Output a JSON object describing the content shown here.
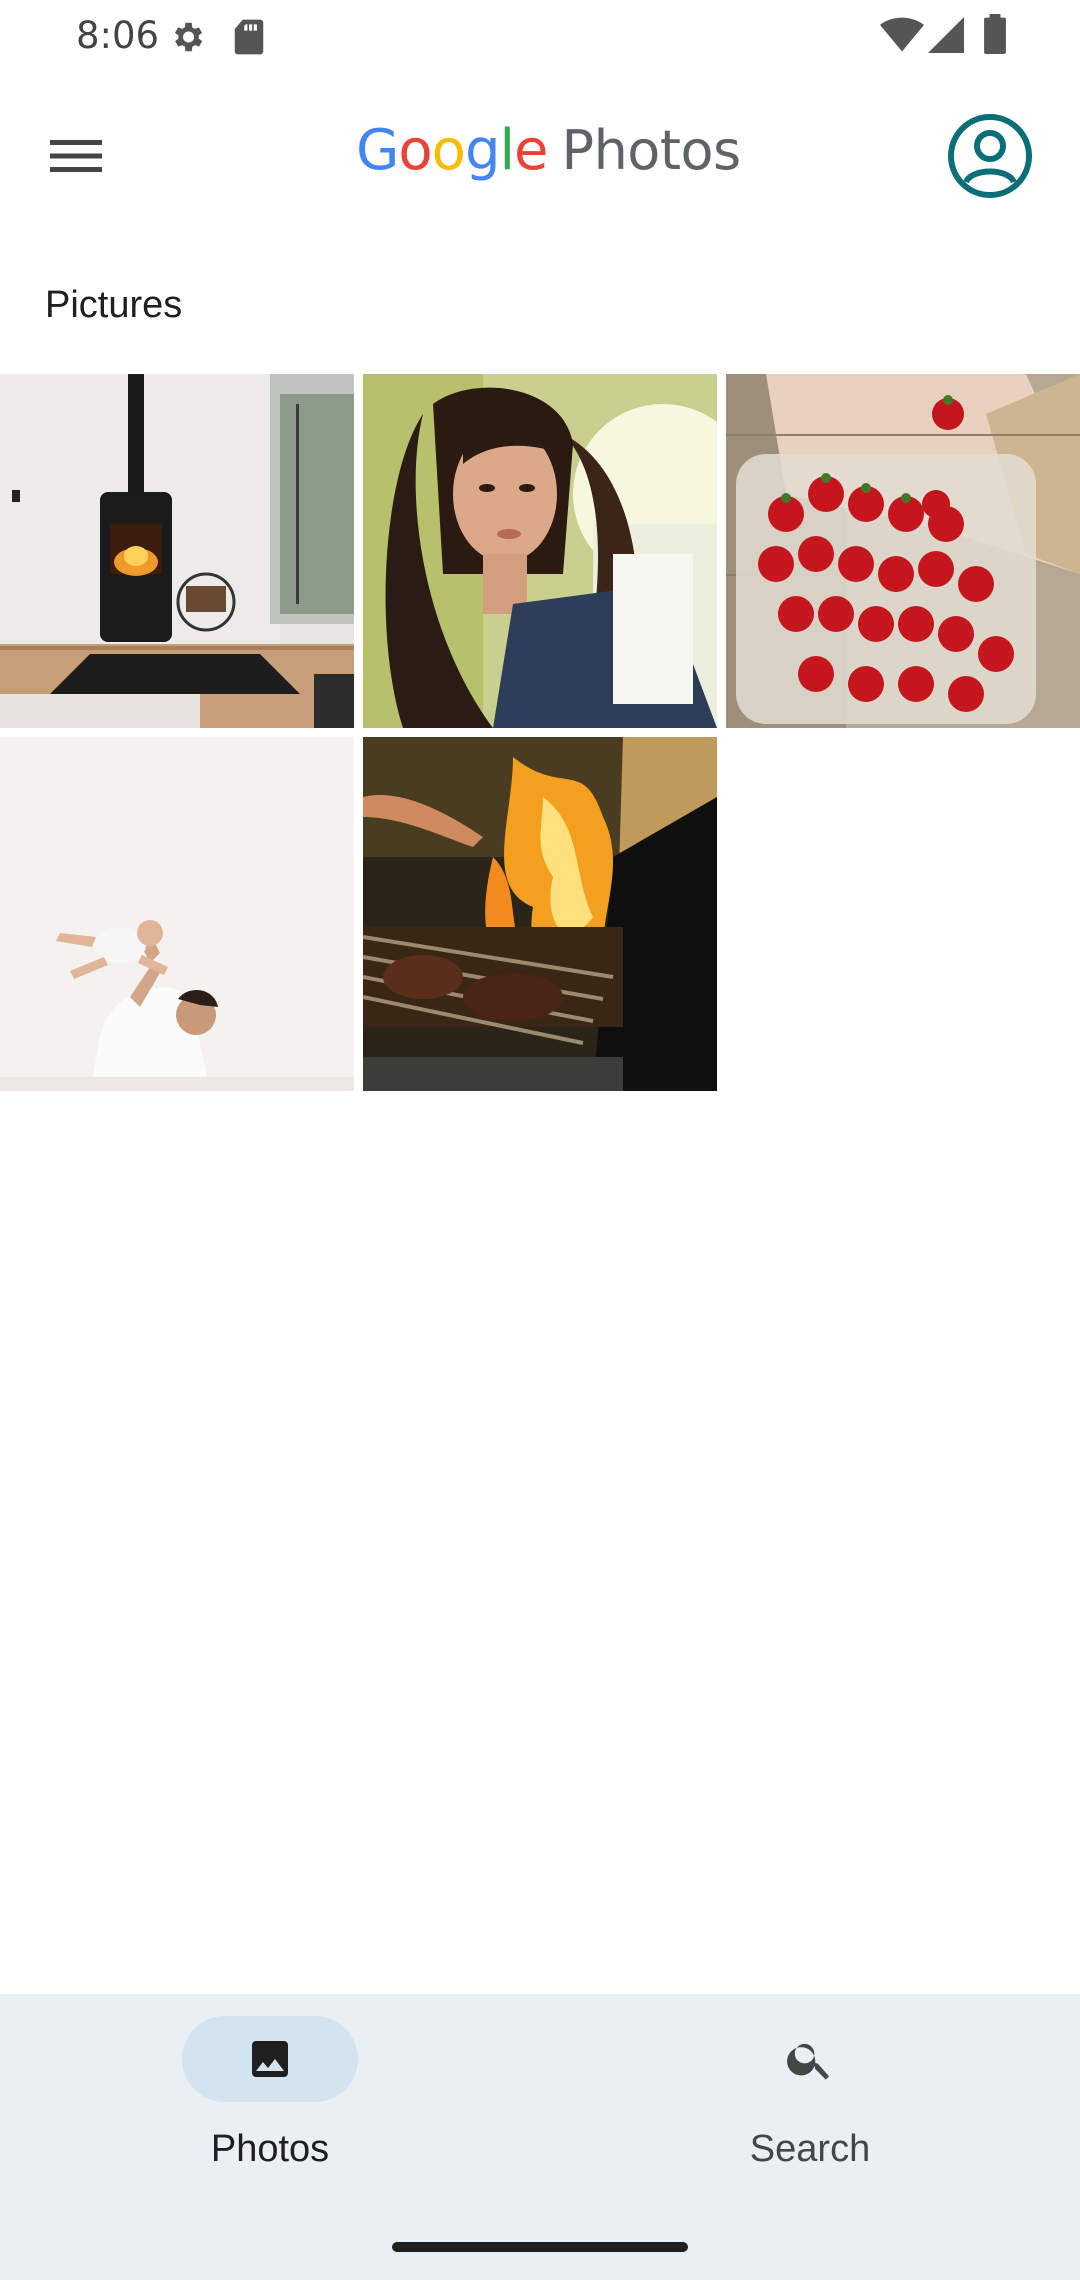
{
  "status_bar": {
    "time": "8:06",
    "icons": [
      "settings-icon",
      "sd-card-icon",
      "wifi-icon",
      "cellular-signal-icon",
      "battery-icon"
    ]
  },
  "app_bar": {
    "logo_word": "Google",
    "logo_letters": [
      "G",
      "o",
      "o",
      "g",
      "l",
      "e"
    ],
    "logo_colors": [
      "#4285F4",
      "#EA4335",
      "#FBBC05",
      "#4285F4",
      "#34A853",
      "#EA4335"
    ],
    "product_name": "Photos",
    "menu_icon": "hamburger-menu-icon",
    "account_icon": "account-circle-icon",
    "accent": "#0b6e79"
  },
  "section": {
    "title": "Pictures"
  },
  "photos": [
    {
      "subject": "fireplace-stove",
      "index": 1
    },
    {
      "subject": "woman-portrait",
      "index": 2
    },
    {
      "subject": "strawberries",
      "index": 3
    },
    {
      "subject": "father-baby",
      "index": 4
    },
    {
      "subject": "grill-fire",
      "index": 5
    }
  ],
  "bottom_nav": {
    "items": [
      {
        "label": "Photos",
        "icon": "photo-icon",
        "selected": true
      },
      {
        "label": "Search",
        "icon": "search-icon",
        "selected": false
      }
    ]
  }
}
